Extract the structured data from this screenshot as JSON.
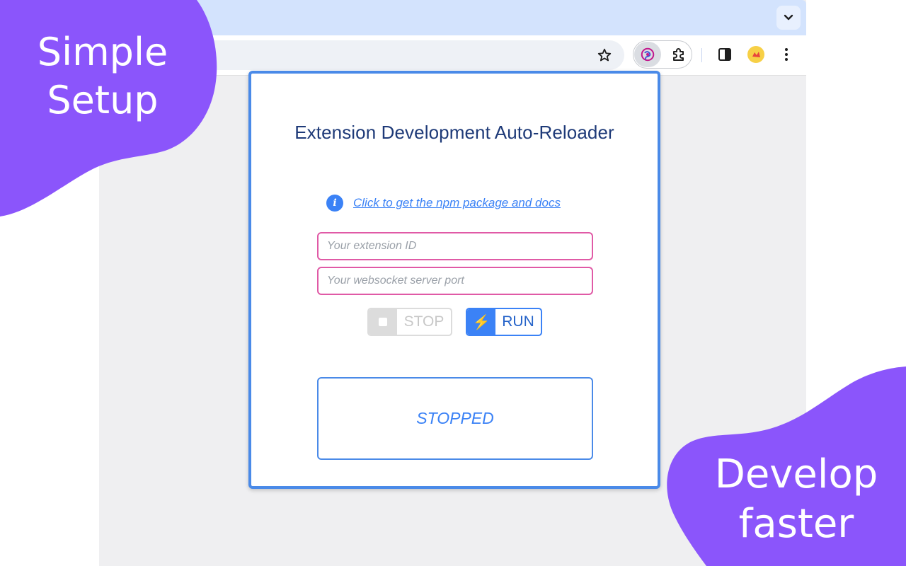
{
  "banner": {
    "top_left": {
      "line1": "Simple",
      "line2": "Setup"
    },
    "bottom_right": {
      "line1": "Develop",
      "line2": "faster"
    },
    "blob_color": "#8b55fb"
  },
  "browser": {
    "icons": [
      "chevron-down-icon",
      "star-icon",
      "extension-logo-icon",
      "puzzle-icon",
      "side-panel-icon",
      "avatar-icon",
      "more-vert-icon"
    ]
  },
  "popup": {
    "title": "Extension Development Auto-Reloader",
    "docs_link": "Click to get the npm package and docs",
    "extension_id_input": {
      "value": "",
      "placeholder": "Your extension ID"
    },
    "port_input": {
      "value": "",
      "placeholder": "Your websocket server port"
    },
    "stop_button": {
      "label": "STOP",
      "enabled": false
    },
    "run_button": {
      "label": "RUN",
      "enabled": true
    },
    "status": "STOPPED",
    "colors": {
      "accent": "#3b82f6",
      "input_border": "#e05aa6",
      "title": "#1e3a78",
      "frame": "#4a8ae8"
    }
  }
}
